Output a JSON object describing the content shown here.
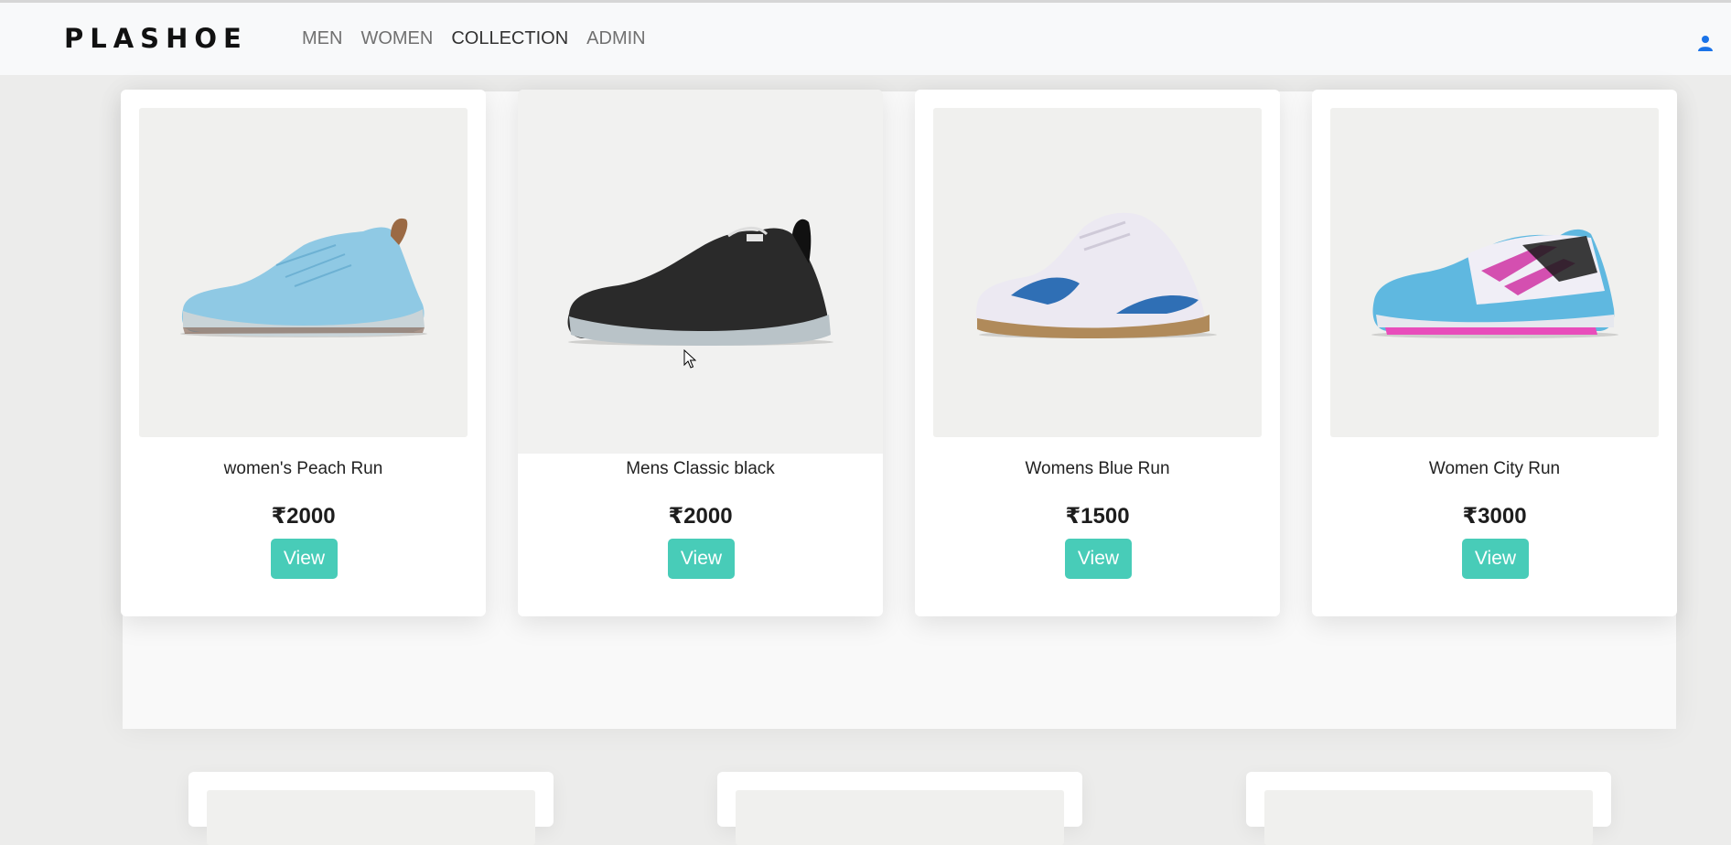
{
  "brand": "PLASHOE",
  "nav": [
    {
      "label": "MEN"
    },
    {
      "label": "WOMEN"
    },
    {
      "label": "COLLECTION"
    },
    {
      "label": "ADMIN"
    }
  ],
  "header": {
    "user_icon": "user-icon"
  },
  "colors": {
    "accent": "#48ccb8",
    "user_icon": "#1a73e8",
    "header_bg": "#f8f9fa",
    "page_bg": "#ececeb"
  },
  "products": [
    {
      "name": "women's Peach Run",
      "price": "₹2000",
      "button": "View",
      "icon": "sky-blue-sneaker"
    },
    {
      "name": "Mens Classic black",
      "price": "₹2000",
      "button": "View",
      "icon": "black-sneaker"
    },
    {
      "name": "Womens Blue Run",
      "price": "₹1500",
      "button": "View",
      "icon": "white-blue-sneaker"
    },
    {
      "name": "Women City Run",
      "price": "₹3000",
      "button": "View",
      "icon": "blue-pink-sneaker"
    }
  ]
}
